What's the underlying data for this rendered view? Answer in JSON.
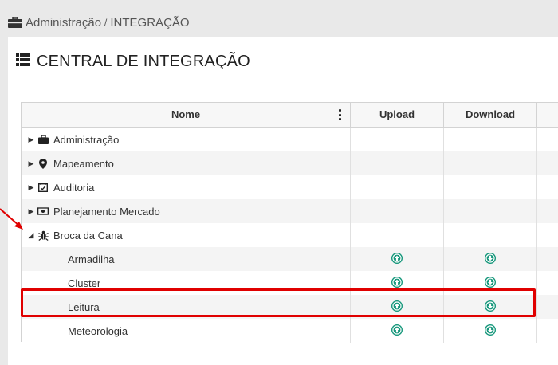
{
  "breadcrumb": {
    "root": "Administração",
    "separator": "/",
    "current": "INTEGRAÇÃO",
    "icon": "briefcase-icon"
  },
  "page": {
    "title": "CENTRAL DE INTEGRAÇÃO",
    "icon": "list-icon"
  },
  "grid": {
    "columns": {
      "name": "Nome",
      "upload": "Upload",
      "download": "Download"
    },
    "rows": [
      {
        "label": "Administração",
        "icon": "briefcase-icon",
        "expanded": false
      },
      {
        "label": "Mapeamento",
        "icon": "map-marker-icon",
        "expanded": false
      },
      {
        "label": "Auditoria",
        "icon": "calendar-check-icon",
        "expanded": false
      },
      {
        "label": "Planejamento Mercado",
        "icon": "money-bill-icon",
        "expanded": false
      },
      {
        "label": "Broca da Cana",
        "icon": "bug-icon",
        "expanded": true
      },
      {
        "label": "Armadilha",
        "upload_icon": "upload-circle-icon",
        "download_icon": "download-circle-icon"
      },
      {
        "label": "Cluster",
        "upload_icon": "upload-circle-icon",
        "download_icon": "download-circle-icon"
      },
      {
        "label": "Leitura",
        "upload_icon": "upload-circle-icon",
        "download_icon": "download-circle-icon",
        "highlighted": true
      },
      {
        "label": "Meteorologia",
        "upload_icon": "upload-circle-icon",
        "download_icon": "download-circle-icon"
      }
    ]
  },
  "colors": {
    "action_icon": "#14967a",
    "highlight": "#e00000",
    "arrow": "#e00000"
  }
}
